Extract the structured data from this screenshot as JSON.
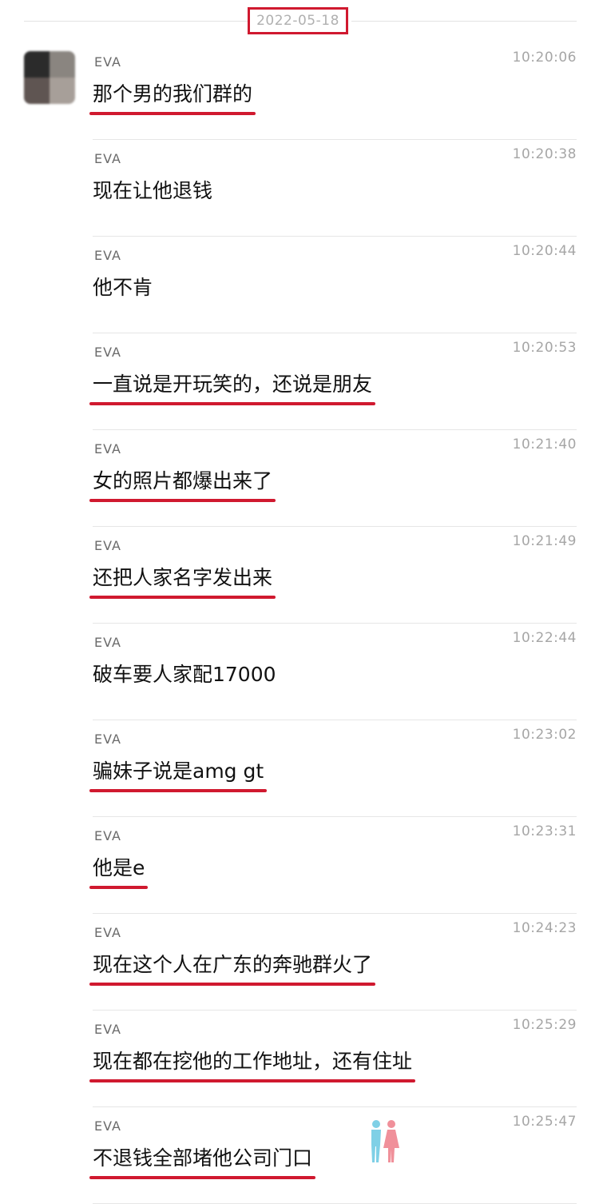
{
  "date_header": "2022-05-18",
  "accent_color": "#d0192f",
  "avatar": "avatar-image-blurred",
  "messages": [
    {
      "sender": "EVA",
      "time": "10:20:06",
      "text": "那个男的我们群的",
      "underlined": true
    },
    {
      "sender": "EVA",
      "time": "10:20:38",
      "text": "现在让他退钱",
      "underlined": false
    },
    {
      "sender": "EVA",
      "time": "10:20:44",
      "text": "他不肯",
      "underlined": false
    },
    {
      "sender": "EVA",
      "time": "10:20:53",
      "text": "一直说是开玩笑的，还说是朋友",
      "underlined": true
    },
    {
      "sender": "EVA",
      "time": "10:21:40",
      "text": "女的照片都爆出来了",
      "underlined": true
    },
    {
      "sender": "EVA",
      "time": "10:21:49",
      "text": "还把人家名字发出来",
      "underlined": true
    },
    {
      "sender": "EVA",
      "time": "10:22:44",
      "text": "破车要人家配17000",
      "underlined": false
    },
    {
      "sender": "EVA",
      "time": "10:23:02",
      "text": "骗妹子说是amg gt",
      "underlined": true
    },
    {
      "sender": "EVA",
      "time": "10:23:31",
      "text": "他是e",
      "underlined": true
    },
    {
      "sender": "EVA",
      "time": "10:24:23",
      "text": "现在这个人在广东的奔驰群火了",
      "underlined": true
    },
    {
      "sender": "EVA",
      "time": "10:25:29",
      "text": "现在都在挖他的工作地址，还有住址",
      "underlined": true
    },
    {
      "sender": "EVA",
      "time": "10:25:47",
      "text": "不退钱全部堵他公司门口",
      "underlined": true
    }
  ]
}
